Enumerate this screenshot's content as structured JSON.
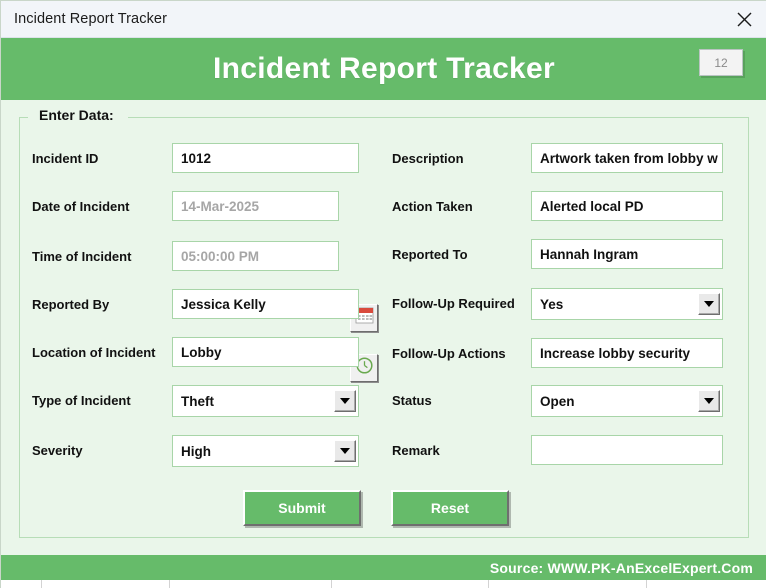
{
  "window": {
    "titlebar_text": "Incident Report Tracker",
    "close_icon": "close-icon"
  },
  "header": {
    "title": "Incident Report Tracker",
    "record_counter": "12",
    "banner_color": "#66bb6a"
  },
  "groupbox": {
    "label": "Enter Data:"
  },
  "form": {
    "left_fields": [
      {
        "label": "Incident ID",
        "value": "1012",
        "type": "text",
        "placeholder": false
      },
      {
        "label": "Date of Incident",
        "value": "14-Mar-2025",
        "type": "date",
        "placeholder": true,
        "picker": "calendar-icon"
      },
      {
        "label": "Time of Incident",
        "value": "05:00:00 PM",
        "type": "time",
        "placeholder": true,
        "picker": "clock-icon"
      },
      {
        "label": "Reported By",
        "value": "Jessica Kelly",
        "type": "text",
        "placeholder": false
      },
      {
        "label": "Location of Incident",
        "value": "Lobby",
        "type": "text",
        "placeholder": false
      },
      {
        "label": "Type of Incident",
        "value": "Theft",
        "type": "combobox",
        "placeholder": false
      },
      {
        "label": "Severity",
        "value": "High",
        "type": "combobox",
        "placeholder": false
      }
    ],
    "right_fields": [
      {
        "label": "Description",
        "value": "Artwork taken from lobby w",
        "type": "text",
        "placeholder": false
      },
      {
        "label": "Action Taken",
        "value": "Alerted local PD",
        "type": "text",
        "placeholder": false
      },
      {
        "label": "Reported To",
        "value": "Hannah Ingram",
        "type": "text",
        "placeholder": false
      },
      {
        "label": "Follow-Up Required",
        "value": "Yes",
        "type": "combobox",
        "placeholder": false
      },
      {
        "label": "Follow-Up Actions",
        "value": "Increase lobby security",
        "type": "text",
        "placeholder": false
      },
      {
        "label": "Status",
        "value": "Open",
        "type": "combobox",
        "placeholder": false
      },
      {
        "label": "Remark",
        "value": "",
        "type": "text",
        "placeholder": false
      }
    ]
  },
  "buttons": {
    "submit": "Submit",
    "reset": "Reset"
  },
  "footer": {
    "source_text": "Source: WWW.PK-AnExcelExpert.Com"
  }
}
